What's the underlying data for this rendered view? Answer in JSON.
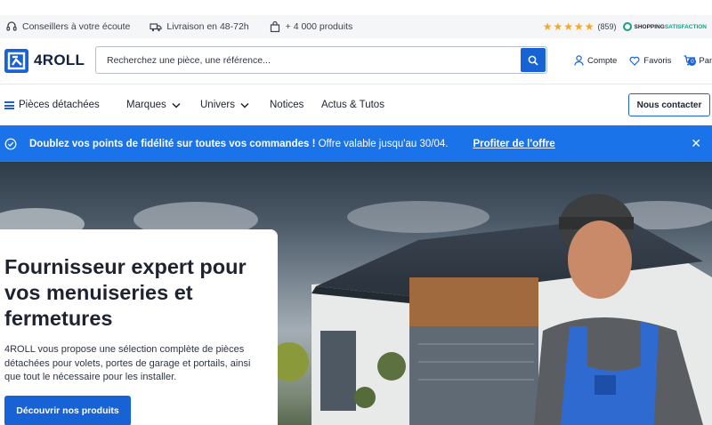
{
  "topbar": {
    "usps": [
      {
        "icon": "headset-icon",
        "label": "Conseillers à votre écoute"
      },
      {
        "icon": "truck-icon",
        "label": "Livraison en 48-72h"
      },
      {
        "icon": "bag-icon",
        "label": "+ 4 000 produits"
      }
    ],
    "rating": {
      "stars": 4.5,
      "stars_text": "★★★★★",
      "count": "(859)",
      "badge_part1": "SHOPPING",
      "badge_part2": "SATISFACTION"
    }
  },
  "header": {
    "logo_text": "4ROLL",
    "search_placeholder": "Recherchez une pièce, une référence...",
    "links": {
      "account": "Compte",
      "favorites": "Favoris",
      "cart": "Panier",
      "cart_count": "0"
    }
  },
  "nav": {
    "items": [
      {
        "label": "Pièces détachées",
        "icon": "menu-icon"
      },
      {
        "label": "Marques",
        "icon": "chevron-down-icon"
      },
      {
        "label": "Univers",
        "icon": "chevron-down-icon"
      },
      {
        "label": "Notices"
      },
      {
        "label": "Actus & Tutos"
      }
    ],
    "contact_button": "Nous contacter"
  },
  "promo": {
    "bold_text": "Doublez vos points de fidélité sur toutes vos commandes !",
    "text": " Offre valable jusqu'au 30/04.",
    "cta": "Profiter de l'offre",
    "close": "✕"
  },
  "hero": {
    "title": "Fournisseur expert pour vos menuiseries et fermetures",
    "text": "4ROLL vous propose une sélection complète de pièces détachées pour volets, portes de garage et portails, ainsi que tout le nécessaire pour les installer.",
    "button": "Découvrir nos produits"
  },
  "colors": {
    "accent": "#1763d6",
    "promo_bg": "#1a73e8",
    "star": "#f5a623",
    "badge": "#16a085"
  }
}
